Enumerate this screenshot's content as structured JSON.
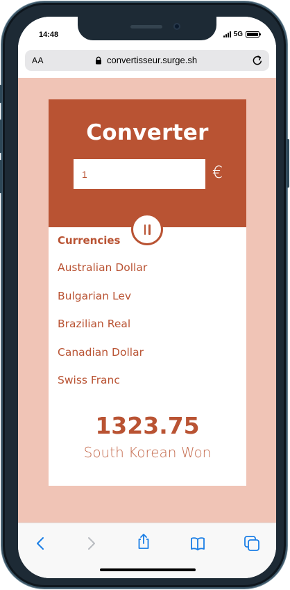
{
  "status_bar": {
    "time": "14:48",
    "network": "5G"
  },
  "browser": {
    "text_size_label": "AA",
    "url": "convertisseur.surge.sh"
  },
  "converter": {
    "title": "Converter",
    "amount_value": "1",
    "currency_symbol": "€",
    "section_label": "Currencies",
    "currencies": [
      "Australian Dollar",
      "Bulgarian Lev",
      "Brazilian Real",
      "Canadian Dollar",
      "Swiss Franc"
    ],
    "result_value": "1323.75",
    "result_currency": "South Korean Won"
  },
  "toolbar": {
    "icons": [
      "back-icon",
      "forward-icon",
      "share-icon",
      "bookmarks-icon",
      "tabs-icon"
    ]
  },
  "colors": {
    "accent": "#b95333",
    "page_background": "#f0c4b6",
    "ios_blue": "#1a7ee6"
  }
}
